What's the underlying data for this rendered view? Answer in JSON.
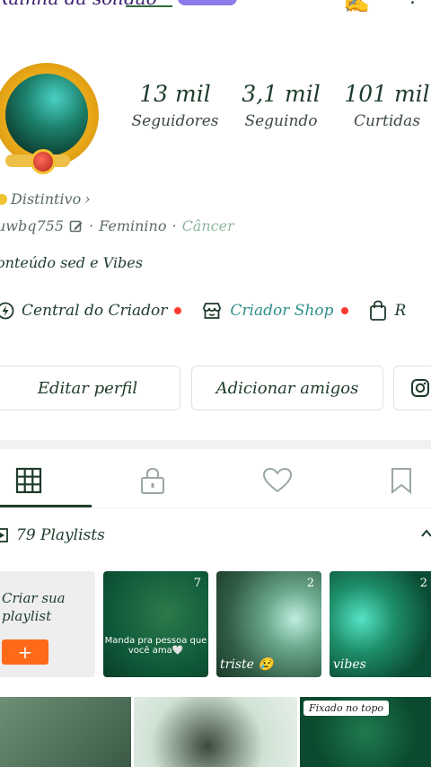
{
  "header": {
    "title_partial": "Rainha da solidão"
  },
  "stats": [
    {
      "value": "13 mil",
      "label": "Seguidores"
    },
    {
      "value": "3,1 mil",
      "label": "Seguindo"
    },
    {
      "value": "101 mil",
      "label": "Curtidas"
    }
  ],
  "badge": {
    "label": "Distintivo",
    "chevron": "›"
  },
  "info": {
    "uid": "uwbq755",
    "sep": "·",
    "gender": "Feminino",
    "sign": "Câncer"
  },
  "bio": "onteúdo sed e Vibes",
  "creator": {
    "central_label": "Central do Criador",
    "shop_label": "Criador Shop",
    "third_label_partial": "R"
  },
  "buttons": {
    "edit": "Editar perfil",
    "add_friends": "Adicionar amigos"
  },
  "playlists": {
    "title": "79 Playlists",
    "create_label": "Criar sua playlist",
    "create_btn": "+",
    "cards": [
      {
        "count": "7",
        "caption": "",
        "middle": "Manda pra pessoa que você ama🤍"
      },
      {
        "count": "2",
        "caption": "triste 😢",
        "middle": ""
      },
      {
        "count": "2",
        "caption": "vibes",
        "middle": ""
      }
    ]
  },
  "grid": {
    "pinned_label": "Fixado no topo"
  },
  "colors": {
    "accent_green": "#1e3b2a",
    "orange": "#ff6a1a",
    "red_dot": "#ff3b30",
    "card_green": "#0f5a3a"
  }
}
